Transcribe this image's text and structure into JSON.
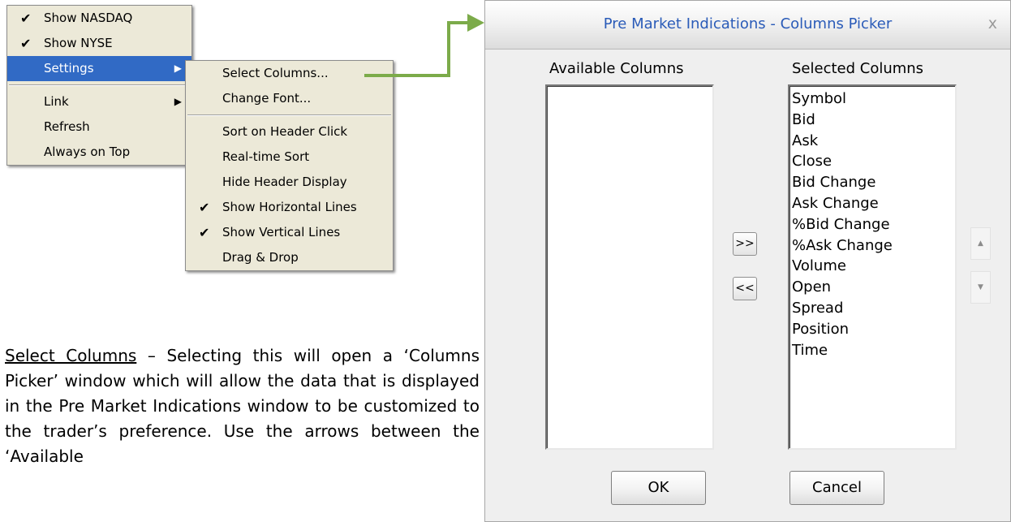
{
  "main_menu": {
    "items": [
      {
        "label": "Show NASDAQ",
        "checked": "✔"
      },
      {
        "label": "Show NYSE",
        "checked": "✔"
      },
      {
        "label": "Settings",
        "submenu_arrow": "▶"
      },
      {
        "label": "Link",
        "submenu_arrow": "▶"
      },
      {
        "label": "Refresh"
      },
      {
        "label": "Always on Top"
      }
    ],
    "highlight_color": "#316ac5"
  },
  "settings_menu": {
    "items": [
      {
        "label": "Select Columns..."
      },
      {
        "label": "Change Font..."
      },
      {
        "label": "Sort on Header Click"
      },
      {
        "label": "Real-time Sort"
      },
      {
        "label": "Hide Header Display"
      },
      {
        "label": "Show Horizontal Lines",
        "checked": "✔"
      },
      {
        "label": "Show Vertical Lines",
        "checked": "✔"
      },
      {
        "label": "Drag & Drop"
      }
    ]
  },
  "connector": {
    "color": "#7cab4a",
    "icon": "arrow-right-icon"
  },
  "description": {
    "heading": "Select Columns",
    "dash": " – ",
    "body": "Selecting this will open a ‘Columns Picker’ window which will allow the data that is displayed in the Pre Market Indications window to be customized to the trader’s preference. Use the arrows between the ‘Available"
  },
  "dialog": {
    "title": "Pre Market Indications - Columns Picker",
    "title_color": "#2a5bb8",
    "close_glyph": "x",
    "available_label": "Available Columns",
    "selected_label": "Selected Columns",
    "available_columns": [],
    "selected_columns": [
      "Symbol",
      "Bid",
      "Ask",
      "Close",
      "Bid Change",
      "Ask Change",
      "%Bid Change",
      "%Ask Change",
      "Volume",
      "Open",
      "Spread",
      "Position",
      "Time"
    ],
    "add_button": ">>",
    "remove_button": "<<",
    "move_up_glyph": "▲",
    "move_down_glyph": "▼",
    "ok_label": "OK",
    "cancel_label": "Cancel"
  }
}
